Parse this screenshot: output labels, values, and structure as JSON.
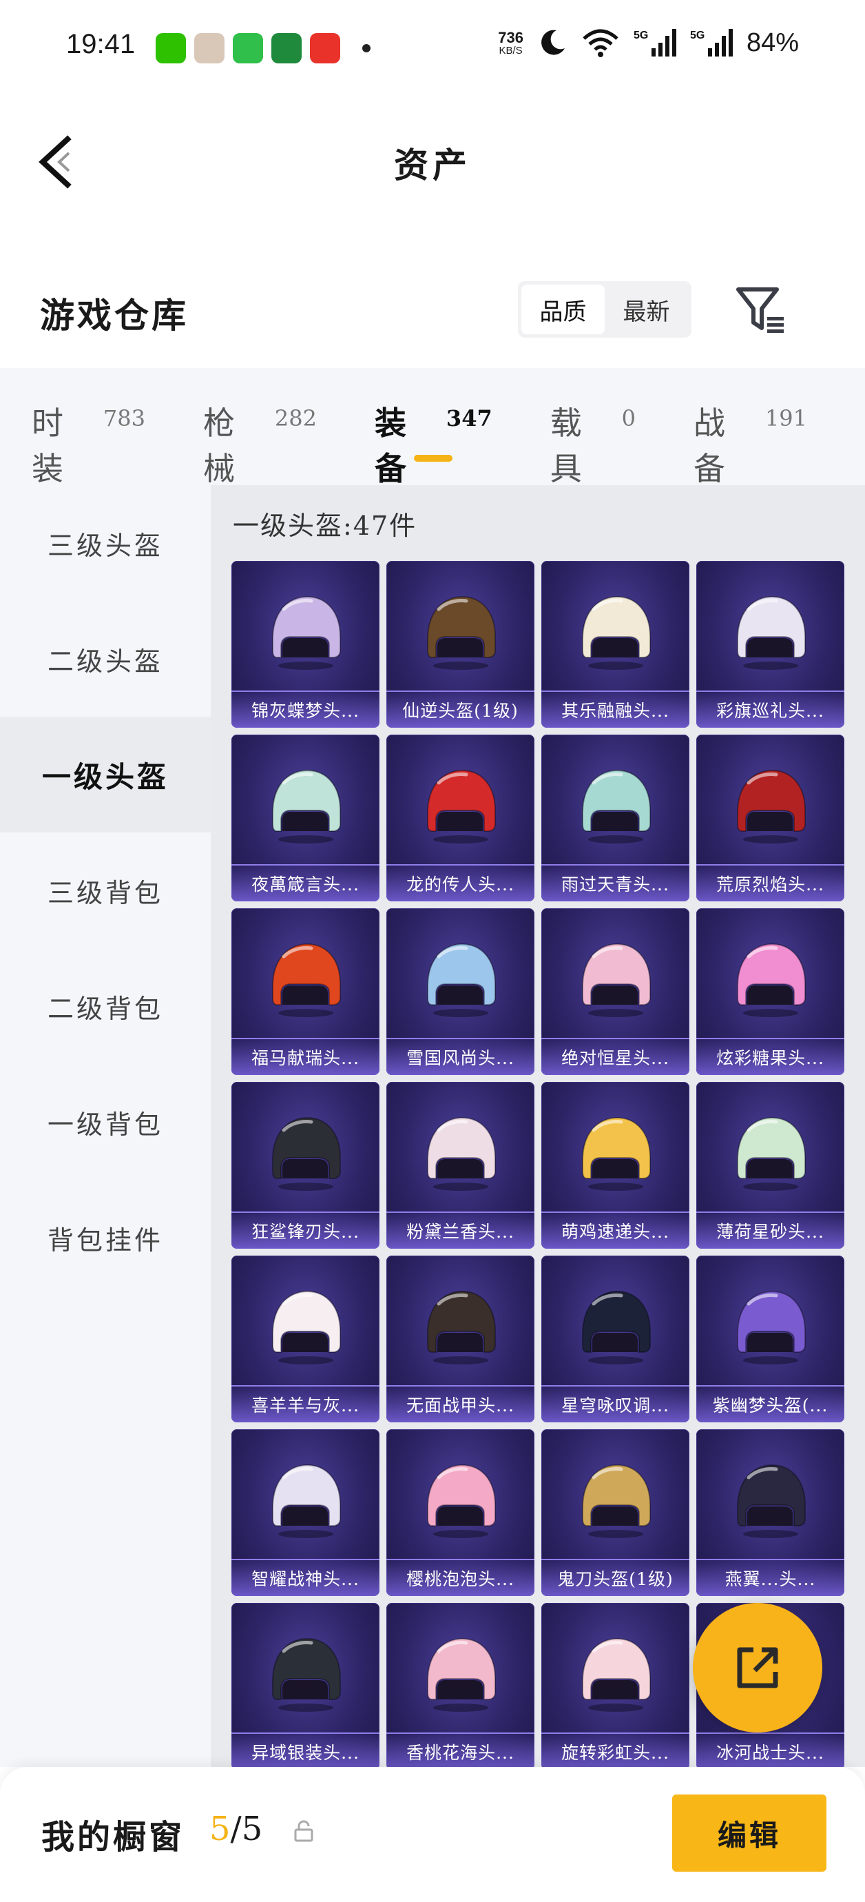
{
  "status_bar": {
    "time": "19:41",
    "apps": [
      {
        "icon": "wechat-icon",
        "color": "#2dc100"
      },
      {
        "icon": "avatar-app-icon",
        "color": "#d9c7b8"
      },
      {
        "icon": "shield-app-icon",
        "color": "#2fbf4a"
      },
      {
        "icon": "bank-app-icon",
        "color": "#1f8a3c"
      },
      {
        "icon": "red-app-icon",
        "color": "#e8322a"
      }
    ],
    "net_speed": "736",
    "net_unit": "KB/S",
    "battery": "84%"
  },
  "header": {
    "title": "资产"
  },
  "warehouse": {
    "title": "游戏仓库",
    "sort_options": [
      "品质",
      "最新"
    ],
    "active_sort": 0
  },
  "tabs": [
    {
      "label": "时装",
      "count": "783",
      "active": false
    },
    {
      "label": "枪械",
      "count": "282",
      "active": false
    },
    {
      "label": "装备",
      "count": "347",
      "active": true
    },
    {
      "label": "载具",
      "count": "0",
      "active": false
    },
    {
      "label": "战备",
      "count": "191",
      "active": false
    }
  ],
  "side_nav": [
    {
      "label": "三级头盔",
      "active": false
    },
    {
      "label": "二级头盔",
      "active": false
    },
    {
      "label": "一级头盔",
      "active": true
    },
    {
      "label": "三级背包",
      "active": false
    },
    {
      "label": "二级背包",
      "active": false
    },
    {
      "label": "一级背包",
      "active": false
    },
    {
      "label": "背包挂件",
      "active": false
    }
  ],
  "section_title": "一级头盔:47件",
  "items": [
    {
      "name": "锦灰蝶梦头...",
      "color": "#c9b6e6"
    },
    {
      "name": "仙逆头盔(1级)",
      "color": "#6b4a2a"
    },
    {
      "name": "其乐融融头...",
      "color": "#f2ead7"
    },
    {
      "name": "彩旗巡礼头...",
      "color": "#e8e4f2"
    },
    {
      "name": "夜萬箴言头...",
      "color": "#bfe3d8"
    },
    {
      "name": "龙的传人头...",
      "color": "#d42a2a"
    },
    {
      "name": "雨过天青头...",
      "color": "#a7d9d3"
    },
    {
      "name": "荒原烈焰头...",
      "color": "#b32222"
    },
    {
      "name": "福马献瑞头...",
      "color": "#e0471f"
    },
    {
      "name": "雪国风尚头...",
      "color": "#9cc6ec"
    },
    {
      "name": "绝对恒星头...",
      "color": "#f1bcd2"
    },
    {
      "name": "炫彩糖果头...",
      "color": "#f08ed1"
    },
    {
      "name": "狂鲨锋刃头...",
      "color": "#2c2e36"
    },
    {
      "name": "粉黛兰香头...",
      "color": "#efdde6"
    },
    {
      "name": "萌鸡速递头...",
      "color": "#f2c24a"
    },
    {
      "name": "薄荷星砂头...",
      "color": "#cfe8d0"
    },
    {
      "name": "喜羊羊与灰...",
      "color": "#f7eef2"
    },
    {
      "name": "无面战甲头...",
      "color": "#3a2f2a"
    },
    {
      "name": "星穹咏叹调...",
      "color": "#1c2238"
    },
    {
      "name": "紫幽梦头盔(...",
      "color": "#7a5bd0"
    },
    {
      "name": "智耀战神头...",
      "color": "#e6e1f2"
    },
    {
      "name": "樱桃泡泡头...",
      "color": "#f4a9c6"
    },
    {
      "name": "鬼刀头盔(1级)",
      "color": "#cfa85a"
    },
    {
      "name": "燕翼...头...",
      "color": "#2a2840"
    },
    {
      "name": "异域银装头...",
      "color": "#2b3038"
    },
    {
      "name": "香桃花海头...",
      "color": "#f2b8cc"
    },
    {
      "name": "旋转彩虹头...",
      "color": "#f6d6dc"
    },
    {
      "name": "冰河战士头...",
      "color": "#5b8ad8"
    }
  ],
  "bottom_bar": {
    "label": "我的橱窗",
    "current": "5",
    "total": "/5",
    "edit_label": "编辑"
  },
  "colors": {
    "accent": "#f5b316",
    "card_bg": "#2d2466",
    "name_bar": "#7862dc"
  }
}
